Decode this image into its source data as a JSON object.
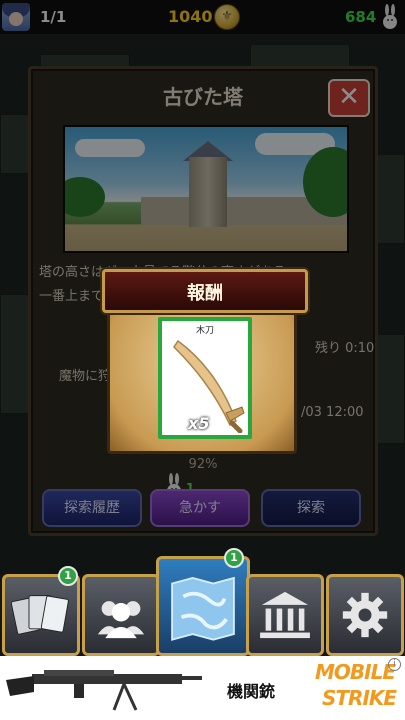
{
  "status_bar": {
    "party": "1/1",
    "gold": "1040",
    "coin_symbol": "⚜",
    "stamina": "684"
  },
  "panel": {
    "title": "古びた塔",
    "close_symbol": "✕",
    "description_line1": "塔の高さはギ　上見てる階分の高さがある。",
    "description_line2": "一番上まで",
    "time_remaining": "残り 0:10",
    "monster_text": "魔物に狩",
    "date_text": "/03 12:00",
    "progress_label": "92%",
    "progress_value": 92,
    "buttons": {
      "history": "探索履歴",
      "hurry": "急かす",
      "explore": "探索"
    },
    "hurry_count": "1"
  },
  "reward": {
    "title": "報酬",
    "item_name": "木刀",
    "item_count": "x5"
  },
  "nav": {
    "cards_badge": "1",
    "map_badge": "1"
  },
  "ad": {
    "text": "機関銃",
    "logo_line1": "MOBILE",
    "logo_line2": "STRIKE",
    "info_symbol": "i"
  }
}
